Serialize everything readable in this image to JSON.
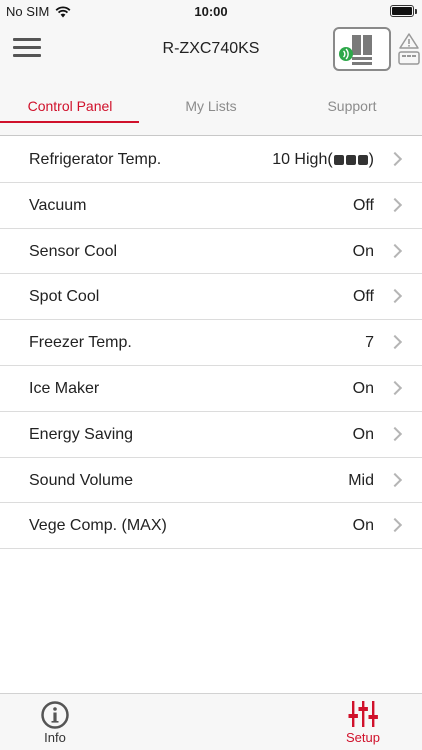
{
  "status_bar": {
    "carrier": "No SIM",
    "time": "10:00"
  },
  "header": {
    "title": "R-ZXC740KS"
  },
  "tabs": [
    {
      "label": "Control Panel",
      "active": true
    },
    {
      "label": "My Lists",
      "active": false
    },
    {
      "label": "Support",
      "active": false
    }
  ],
  "settings": [
    {
      "label": "Refrigerator Temp.",
      "value": "10 High(",
      "value_suffix": ")",
      "level_blocks": 3
    },
    {
      "label": "Vacuum",
      "value": "Off"
    },
    {
      "label": "Sensor Cool",
      "value": "On"
    },
    {
      "label": "Spot Cool",
      "value": "Off"
    },
    {
      "label": "Freezer Temp.",
      "value": "7"
    },
    {
      "label": "Ice Maker",
      "value": "On"
    },
    {
      "label": "Energy Saving",
      "value": "On"
    },
    {
      "label": "Sound Volume",
      "value": "Mid"
    },
    {
      "label": "Vege Comp. (MAX)",
      "value": "On"
    }
  ],
  "bottom_tabs": [
    {
      "label": "Info",
      "icon": "info-icon",
      "active": false
    },
    {
      "label": "Setup",
      "icon": "sliders-icon",
      "active": true
    }
  ],
  "colors": {
    "accent": "#d0112b",
    "connected": "#2ea84a",
    "divider": "#dcdcdc"
  }
}
